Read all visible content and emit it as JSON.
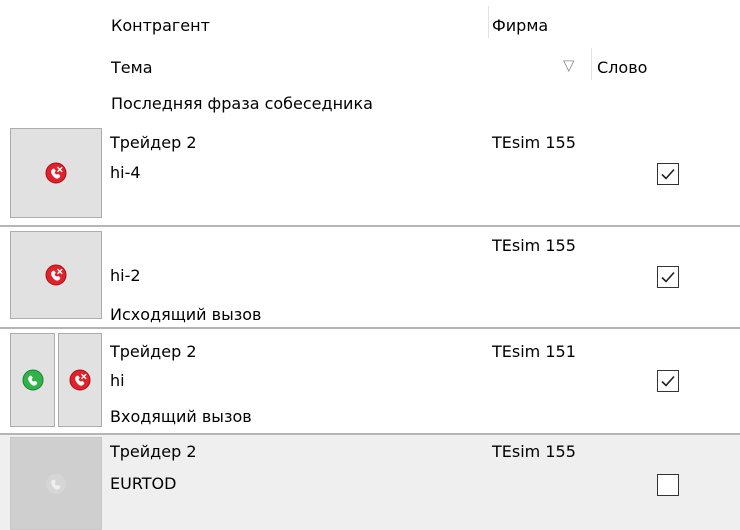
{
  "header": {
    "col_contragent": "Контрагент",
    "col_firm": "Фирма",
    "col_topic": "Тема",
    "col_word": "Слово",
    "col_last_phrase": "Последняя фраза собеседника",
    "sort_glyph": "▽"
  },
  "rows": [
    {
      "contragent": "Трейдер 2",
      "firm": "TEsim 155",
      "topic": "hi-4",
      "last_phrase": "",
      "word_checked": true,
      "buttons": [
        "hangup-icon"
      ]
    },
    {
      "contragent": "",
      "firm": "TEsim 155",
      "topic": "hi-2",
      "last_phrase": "Исходящий вызов",
      "word_checked": true,
      "buttons": [
        "hangup-icon"
      ]
    },
    {
      "contragent": "Трейдер 2",
      "firm": "TEsim 151",
      "topic": "hi",
      "last_phrase": "Входящий вызов",
      "word_checked": true,
      "buttons": [
        "answer-icon",
        "hangup-icon"
      ]
    },
    {
      "contragent": "Трейдер 2",
      "firm": "TEsim 155",
      "topic": "EURTOD",
      "last_phrase": "",
      "word_checked": false,
      "buttons": [
        "phone-disabled-icon"
      ]
    }
  ],
  "colors": {
    "hangup_red": "#e2222a",
    "answer_green": "#2fb34a",
    "row_selected_bg": "#efefef",
    "separator": "#b5b5b5"
  }
}
